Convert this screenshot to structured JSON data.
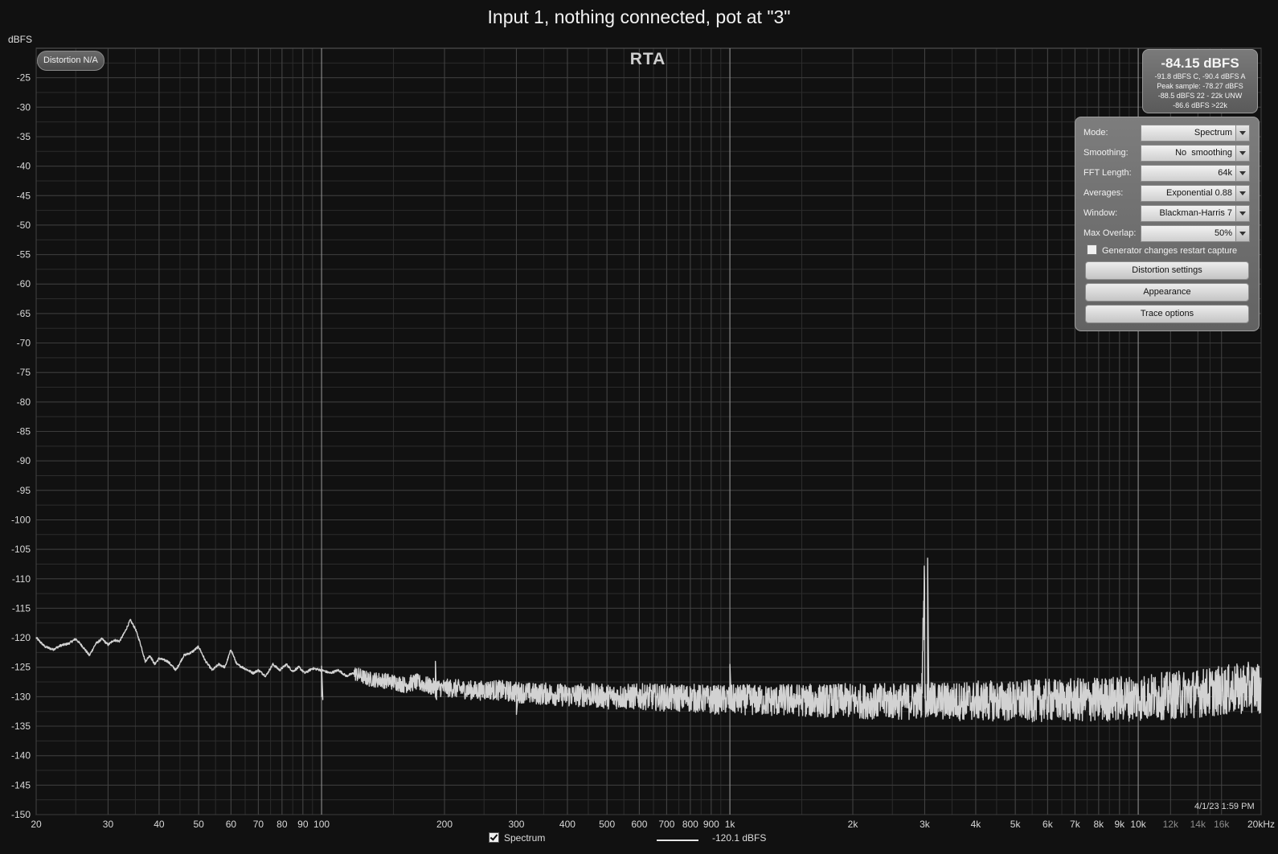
{
  "title": "Input 1, nothing connected, pot at \"3\"",
  "y_unit": "dBFS",
  "graph_label": "RTA",
  "distortion_badge": "Distortion N/A",
  "readout": {
    "main": "-84.15 dBFS",
    "line1": "-91.8 dBFS C, -90.4 dBFS A",
    "line2": "Peak sample: -78.27 dBFS",
    "line3": "-88.5 dBFS 22 - 22k UNW",
    "line4": "-86.6 dBFS >22k"
  },
  "controls": {
    "mode": {
      "label": "Mode:",
      "value": "Spectrum"
    },
    "smoothing": {
      "label": "Smoothing:",
      "value": "No  smoothing"
    },
    "fft_length": {
      "label": "FFT Length:",
      "value": "64k"
    },
    "averages": {
      "label": "Averages:",
      "value": "Exponential 0.88"
    },
    "window": {
      "label": "Window:",
      "value": "Blackman-Harris 7"
    },
    "max_overlap": {
      "label": "Max Overlap:",
      "value": "50%"
    },
    "generator_checkbox": "Generator changes restart capture",
    "distortion_button": "Distortion settings",
    "appearance_button": "Appearance",
    "trace_button": "Trace options"
  },
  "timestamp": "4/1/23 1:59 PM",
  "legend": {
    "name": "Spectrum",
    "value": "-120.1 dBFS"
  },
  "colors": {
    "background": "#111111",
    "trace": "#d2d2d2",
    "grid_major": "#5a5a5a",
    "grid_minor": "#2c2c2c"
  },
  "chart_data": {
    "type": "line",
    "x_scale": "log",
    "xlim": [
      20,
      20000
    ],
    "ylim": [
      -150,
      -20
    ],
    "grid": true,
    "y_ticks": [
      -25,
      -30,
      -35,
      -40,
      -45,
      -50,
      -55,
      -60,
      -65,
      -70,
      -75,
      -80,
      -85,
      -90,
      -95,
      -100,
      -105,
      -110,
      -115,
      -120,
      -125,
      -130,
      -135,
      -140,
      -145,
      -150
    ],
    "x_ticks": [
      {
        "v": 20,
        "label": "20"
      },
      {
        "v": 30,
        "label": "30"
      },
      {
        "v": 40,
        "label": "40"
      },
      {
        "v": 50,
        "label": "50"
      },
      {
        "v": 60,
        "label": "60"
      },
      {
        "v": 70,
        "label": "70"
      },
      {
        "v": 80,
        "label": "80"
      },
      {
        "v": 90,
        "label": "90"
      },
      {
        "v": 100,
        "label": "100"
      },
      {
        "v": 200,
        "label": "200"
      },
      {
        "v": 300,
        "label": "300"
      },
      {
        "v": 400,
        "label": "400"
      },
      {
        "v": 500,
        "label": "500"
      },
      {
        "v": 600,
        "label": "600"
      },
      {
        "v": 700,
        "label": "700"
      },
      {
        "v": 800,
        "label": "800"
      },
      {
        "v": 900,
        "label": "900"
      },
      {
        "v": 1000,
        "label": "1k"
      },
      {
        "v": 2000,
        "label": "2k"
      },
      {
        "v": 3000,
        "label": "3k"
      },
      {
        "v": 4000,
        "label": "4k"
      },
      {
        "v": 5000,
        "label": "5k"
      },
      {
        "v": 6000,
        "label": "6k"
      },
      {
        "v": 7000,
        "label": "7k"
      },
      {
        "v": 8000,
        "label": "8k"
      },
      {
        "v": 9000,
        "label": "9k"
      },
      {
        "v": 10000,
        "label": "10k"
      },
      {
        "v": 12000,
        "label": "12k"
      },
      {
        "v": 14000,
        "label": "14k"
      },
      {
        "v": 16000,
        "label": "16k"
      },
      {
        "v": 20000,
        "label": "20kHz"
      }
    ],
    "series": [
      {
        "x": [
          20,
          21,
          22,
          23,
          24,
          25,
          26,
          27,
          28,
          29,
          30,
          31,
          32,
          33,
          34,
          35,
          36,
          37,
          38,
          39,
          40,
          42,
          44,
          46,
          48,
          50,
          52,
          54,
          56,
          58,
          60,
          62,
          64,
          66,
          68,
          70,
          73,
          76,
          79,
          82,
          85,
          88,
          91,
          95,
          100,
          105,
          110,
          115,
          120,
          130,
          140,
          150,
          160,
          170,
          180,
          190,
          200,
          220,
          240,
          260,
          280,
          300,
          330,
          360,
          400,
          450,
          500,
          560,
          630,
          700,
          800,
          900,
          1000,
          1100,
          1250,
          1400,
          1600,
          1800,
          2000,
          2250,
          2500,
          2750,
          2950,
          3000,
          3050,
          3100,
          3200,
          3500,
          4000,
          4500,
          5000,
          5500,
          6000,
          7000,
          8000,
          9000,
          10000,
          11000,
          12000,
          13000,
          14000,
          15000,
          16000,
          17000,
          18000,
          19000,
          20000
        ],
        "y": [
          -120,
          -121.5,
          -122,
          -121.3,
          -121,
          -120.2,
          -121.5,
          -123,
          -121,
          -120.2,
          -121.2,
          -120.4,
          -120.6,
          -119,
          -117,
          -118.5,
          -121,
          -124,
          -123,
          -124.5,
          -123.5,
          -124,
          -125.5,
          -123,
          -122.5,
          -121.5,
          -124,
          -125.5,
          -124.5,
          -125,
          -122,
          -124.5,
          -125,
          -125.5,
          -126,
          -125.5,
          -126.5,
          -124.5,
          -125.5,
          -124.5,
          -125.7,
          -125,
          -126,
          -125.2,
          -125.5,
          -126,
          -125.5,
          -126.5,
          -126,
          -127,
          -127.2,
          -127.5,
          -128,
          -127.5,
          -128,
          -128.5,
          -128.5,
          -128.7,
          -129,
          -128.8,
          -129,
          -129.2,
          -129.5,
          -129.5,
          -129.8,
          -129.7,
          -130,
          -130,
          -130,
          -130.2,
          -130.2,
          -130.5,
          -130.5,
          -130.5,
          -130.7,
          -130.5,
          -130.7,
          -130.7,
          -130.7,
          -130.8,
          -130.8,
          -130.8,
          -130.5,
          -106.5,
          -130.5,
          -130.8,
          -130.7,
          -130.8,
          -130.7,
          -130.7,
          -130.8,
          -130.7,
          -130.6,
          -130.6,
          -130.5,
          -130.3,
          -130.2,
          -130,
          -129.8,
          -129.6,
          -129.4,
          -129.2,
          -129,
          -128.8,
          -128.6,
          -128.4,
          -128.5
        ],
        "noise_span_db": 3.5,
        "spurs": [
          {
            "x": 1000,
            "y": -124.5
          },
          {
            "x": 3050,
            "y": -106.5
          },
          {
            "x": 300,
            "y": -133
          },
          {
            "x": 100,
            "y": -124.8
          },
          {
            "x": 190,
            "y": -124
          }
        ]
      }
    ]
  }
}
